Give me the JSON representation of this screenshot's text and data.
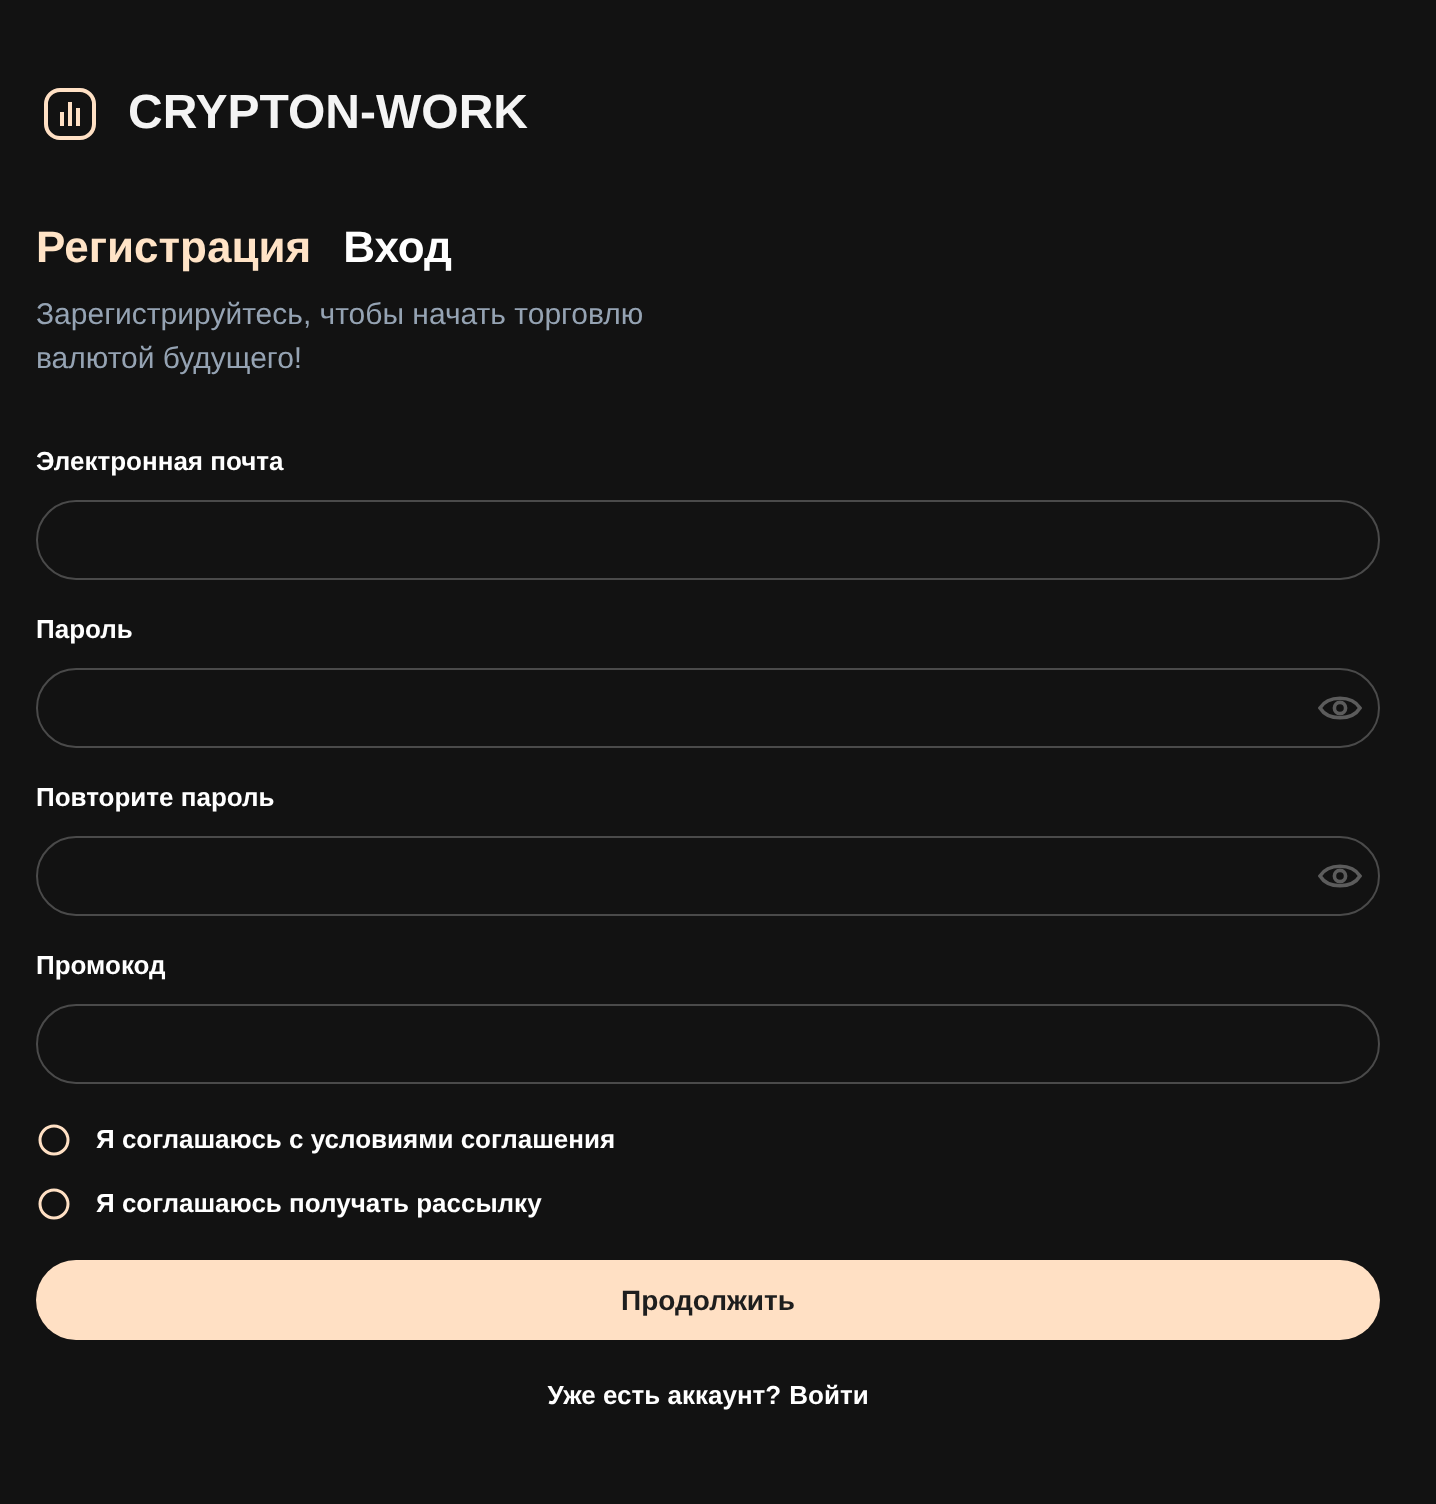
{
  "brand": {
    "name": "CRYPTON-WORK"
  },
  "tabs": [
    {
      "label": "Регистрация",
      "selected": true
    },
    {
      "label": "Вход",
      "selected": false
    }
  ],
  "subtitle": "Зарегистрируйтесь, чтобы начать торговлю валютой будущего!",
  "fields": [
    {
      "label": "Электронная почта",
      "kind": "text"
    },
    {
      "label": "Пароль",
      "kind": "password"
    },
    {
      "label": "Повторите пароль",
      "kind": "password"
    },
    {
      "label": "Промокод",
      "kind": "text"
    }
  ],
  "agreements": [
    {
      "label": "Я соглашаюсь с условиями соглашения",
      "checked": false
    },
    {
      "label": "Я соглашаюсь получать рассылку",
      "checked": false
    }
  ],
  "submit": "Продолжить",
  "footer": {
    "prompt": "Уже есть аккаунт?",
    "link": "Войти"
  }
}
